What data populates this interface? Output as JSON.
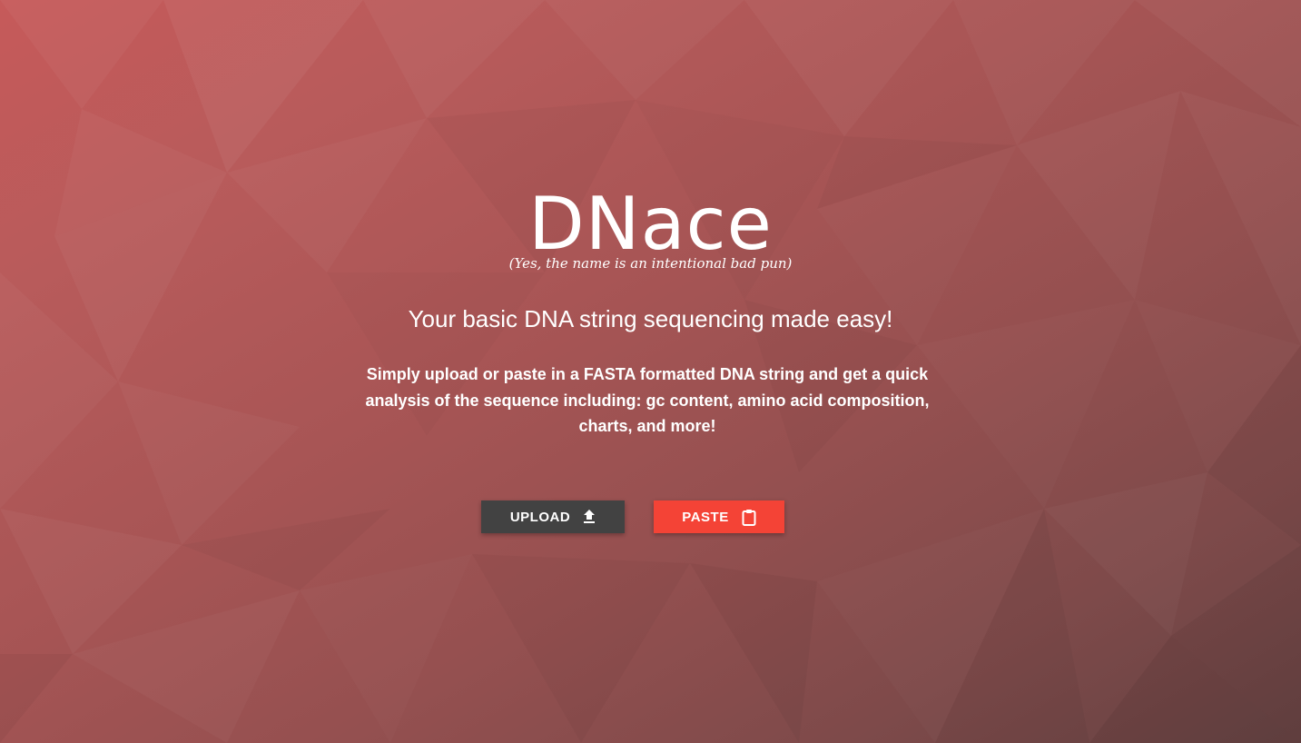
{
  "hero": {
    "logo": "DNace",
    "tagline": "(Yes, the name is an intentional bad pun)",
    "headline": "Your basic DNA string sequencing made easy!",
    "description": "Simply upload or paste in a FASTA formatted DNA string and get a quick analysis of the sequence including:  gc content, amino acid composition, charts, and more!"
  },
  "actions": {
    "upload": {
      "label": "UPLOAD",
      "icon": "upload-icon",
      "color": "#424242"
    },
    "paste": {
      "label": "PASTE",
      "icon": "clipboard-icon",
      "color": "#f44336"
    }
  },
  "theme": {
    "background_start": "#c65a5a",
    "background_end": "#654242",
    "text_color": "#ffffff"
  }
}
